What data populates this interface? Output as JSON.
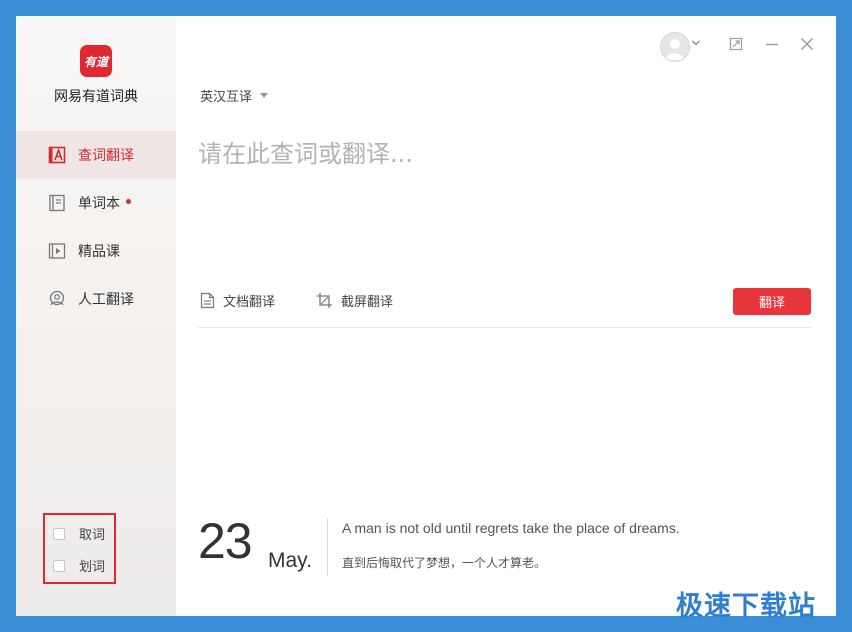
{
  "app": {
    "name": "网易有道词典",
    "logo_text": "有道",
    "brand_color": "#e0282e"
  },
  "sidebar": {
    "items": [
      {
        "label": "查词翻译",
        "icon": "dictionary-a-icon",
        "active": true
      },
      {
        "label": "单词本",
        "icon": "notebook-icon",
        "badge": "red-dot"
      },
      {
        "label": "精品课",
        "icon": "video-course-icon"
      },
      {
        "label": "人工翻译",
        "icon": "human-translate-icon"
      }
    ],
    "options": [
      {
        "label": "取词",
        "checked": false
      },
      {
        "label": "划词",
        "checked": false
      }
    ]
  },
  "header": {
    "avatar_icon": "user-avatar-icon",
    "window_controls": [
      "maximize-icon",
      "minimize-icon",
      "close-icon"
    ]
  },
  "main": {
    "language_select": "英汉互译",
    "search_placeholder": "请在此查词或翻译...",
    "search_value": "",
    "tools": [
      {
        "label": "文档翻译",
        "icon": "document-icon"
      },
      {
        "label": "截屏翻译",
        "icon": "crop-icon"
      }
    ],
    "translate_button": "翻译",
    "accent": "#e8353b"
  },
  "daily": {
    "day": "23",
    "month": "May.",
    "quote_en": "A man is not old until regrets take the place of dreams.",
    "quote_zh": "直到后悔取代了梦想，一个人才算老。"
  },
  "watermark": "极速下载站"
}
